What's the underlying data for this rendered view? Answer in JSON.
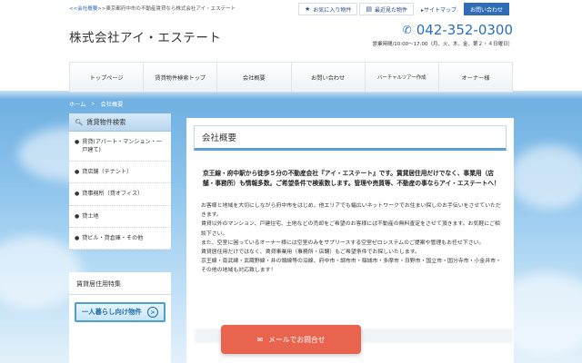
{
  "header": {
    "breadcrumb_top_link": "<<会社概要",
    "breadcrumb_top_rest": ">>東京都府中市の不動産賃貸なら株式会社アイ・エステート",
    "company_name": "株式会社アイ・エステート",
    "favorites_label": "お気に入り物件",
    "favorites_icon": "star-icon",
    "recent_label": "最近見た物件",
    "recent_icon": "doc-icon",
    "sitemap_label": "▸サイトマップ",
    "contact_label": "お問い合わせ",
    "phone": "042-352-0300",
    "phone_icon": "phone-icon",
    "hours": "営業時間/10:00～17:00（月、火、木、金、第２・４日曜日）"
  },
  "nav": {
    "items": [
      "トップページ",
      "賃貸物件検索トップ",
      "会社概要",
      "お問い合わせ",
      "バーチャルツアー作成",
      "オーナー様"
    ]
  },
  "breadcrumb": {
    "home": "ホーム",
    "sep": ">",
    "current": "会社概要"
  },
  "sidebar": {
    "heading": "賃貸物件検索",
    "heading_icon": "search-icon",
    "items": [
      "賃貸(アパート・マンション・一戸建て)",
      "貸店舗（テナント）",
      "貸事務所（貸オフィス）",
      "貸土地",
      "貸ビル・貸倉庫・その他"
    ],
    "feature_heading": "賃貸居住用特集",
    "banner_label": "一人暮らし向け物件"
  },
  "main": {
    "title": "会社概要",
    "lead": "京王線・府中駅から徒歩５分の不動産会社『アイ・エステート』です。賃貸居住用だけでなく、事業用（店舗・事務所）も情報多数。ご希望条件で検索数します。管理や売買等、不動産の事ならアイ・エステートへ！",
    "body": [
      "お客様と地域を大切にしながら府中市をはじめ、他エリアでも幅広いネットワークでお住まい探しのお手伝いをさせていただきます。",
      "賃貸以外のマンション、戸建住宅、土地などの売却をご希望のお客様には不動産の無料査定をさせて頂きます。お気軽にご相談下さい。",
      "また、空室に困っているオーナー様には空室のみをサプリースする空室ゼロシステムのご提案や管理もお任せ下さい。",
      "賃貸居住用だけではなく、賃貸事業用（事務所・店舗）もご希望条件でお探しいたします。",
      "京王線・南武線・武蔵野線・井の頭線等の沿線、府中市・調布市・稲城市・多摩市・日野市・国立市・国分寺市・小金井市・その他の地域も対応致します！"
    ],
    "cta_label": "メールでお問合せ",
    "cta_icon": "mail-icon"
  },
  "colors": {
    "accent": "#2f6db9",
    "phone": "#2a6fbd",
    "cta": "#e8644f",
    "sky": "#6fb0e2"
  }
}
